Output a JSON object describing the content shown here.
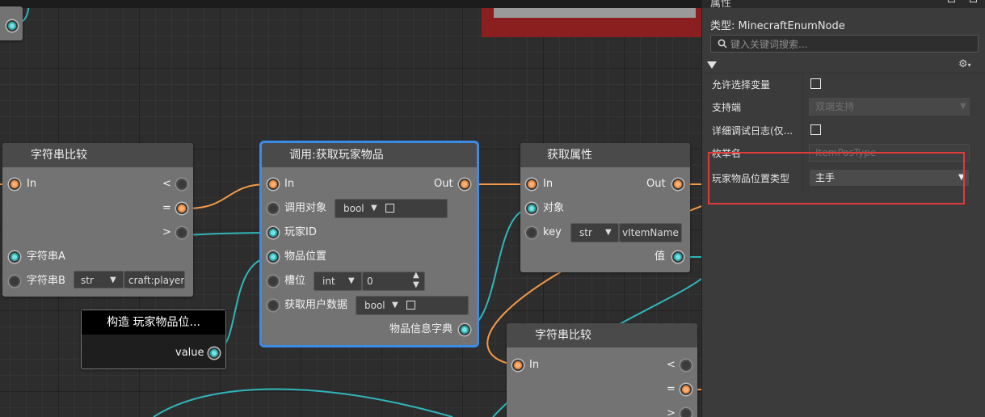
{
  "colors": {
    "exec_wire": "#f39a4a",
    "data_wire": "#31b5b9",
    "selected_outline": "#3c8be6",
    "highlight_box": "#e03a3a",
    "panel_bg": "#3b3b3b"
  },
  "panel": {
    "title": "属性",
    "type_label": "类型: MinecraftEnumNode",
    "search_placeholder": "键入关键词搜索...",
    "collapse_icon": "triangle-down-icon",
    "settings_icon": "gear-icon",
    "properties": [
      {
        "label": "允许选择变量",
        "kind": "checkbox",
        "checked": false
      },
      {
        "label": "支持端",
        "kind": "select",
        "value": "双端支持",
        "disabled": true
      },
      {
        "label": "详细调试日志(仅...",
        "kind": "checkbox",
        "checked": false
      },
      {
        "label": "枚举名",
        "kind": "text",
        "value": "ItemPosType",
        "disabled": true
      },
      {
        "label": "玩家物品位置类型",
        "kind": "select",
        "value": "主手",
        "disabled": false
      }
    ]
  },
  "nodes": {
    "compare1": {
      "title": "字符串比较",
      "in": "In",
      "lt": "<",
      "eq": "=",
      "gt": ">",
      "a": "字符串A",
      "b": "字符串B",
      "b_type": "str",
      "b_value": "craft:player"
    },
    "call": {
      "title": "调用:获取玩家物品",
      "in": "In",
      "out": "Out",
      "target": "调用对象",
      "target_type": "bool",
      "player": "玩家ID",
      "pos": "物品位置",
      "slot": "槽位",
      "slot_type": "int",
      "slot_value": "0",
      "userdata": "获取用户数据",
      "userdata_type": "bool",
      "dict": "物品信息字典"
    },
    "getattr": {
      "title": "获取属性",
      "in": "In",
      "out": "Out",
      "obj": "对象",
      "key": "key",
      "key_type": "str",
      "key_value": "vItemName",
      "val": "值"
    },
    "construct": {
      "title": "构造 玩家物品位...",
      "value": "value"
    },
    "compare2": {
      "title": "字符串比较",
      "in": "In",
      "lt": "<",
      "eq": "=",
      "gt": ">"
    }
  }
}
